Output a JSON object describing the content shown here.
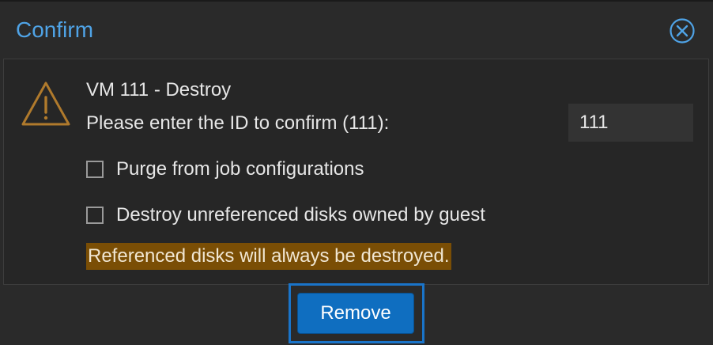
{
  "dialog": {
    "title": "Confirm",
    "close_icon": "close-circle-icon",
    "warning_icon": "warning-triangle-icon",
    "heading": "VM 111 - Destroy",
    "prompt": "Please enter the ID to confirm (111):",
    "id_input": {
      "value": "111",
      "placeholder": ""
    },
    "options": [
      {
        "label": "Purge from job configurations",
        "checked": false
      },
      {
        "label": "Destroy unreferenced disks owned by guest",
        "checked": false
      }
    ],
    "note": "Referenced disks will always be destroyed.",
    "remove_label": "Remove"
  },
  "colors": {
    "title": "#4fa3e6",
    "warning": "#b07a2c",
    "note_bg": "#7a4e05",
    "button": "#0f6ec0",
    "focus_ring": "#1a74c9"
  }
}
